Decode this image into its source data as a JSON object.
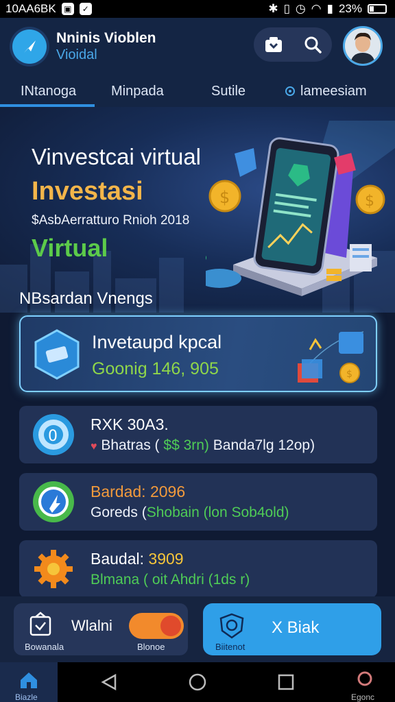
{
  "status_bar": {
    "left_text": "10AA6BK",
    "battery": "23%"
  },
  "header": {
    "title": "Nninis Vioblen",
    "subtitle": "Vioidal"
  },
  "tabs": [
    {
      "label": "INtanoga",
      "active": true
    },
    {
      "label": "Minpada"
    },
    {
      "label": "Sutile"
    },
    {
      "label": "lameesiam"
    }
  ],
  "hero": {
    "line1": "Vinvestcai virtual",
    "line2": "Investasi",
    "line3": "$AsbAerratturo Rnioh 2018",
    "line4": "Virtual"
  },
  "section_title": "NBsardan Vnengs",
  "featured": {
    "title": "Invetaupd kpcal",
    "value": "Goonig 146, 905"
  },
  "cards": [
    {
      "title": "RXK 30A3.",
      "sub_prefix": "Bhatras (",
      "sub_highlight": "$$ 3rn)",
      "sub_suffix": " Banda7lg 12op)"
    },
    {
      "title": "Bardad: 2096",
      "sub_prefix": "Goreds (",
      "sub_highlight": "Shobain (lon Sob4old)",
      "sub_suffix": ""
    },
    {
      "title_prefix": "Baudal: ",
      "title_value": "3909",
      "sub": "Blmana ( oit Ahdri (1ds r)"
    }
  ],
  "action_bar": {
    "wallet_label": "Wlalni",
    "wallet_sub": "Bowanala",
    "toggle_sub": "Blonoe",
    "primary_label": "X Biak",
    "primary_sub": "Biitenot"
  },
  "nav": {
    "home_label": "Biazle",
    "right_label": "Egonc"
  },
  "colors": {
    "accent": "#2f9fe8",
    "gold": "#f3b54a",
    "green": "#5ccb4a"
  }
}
